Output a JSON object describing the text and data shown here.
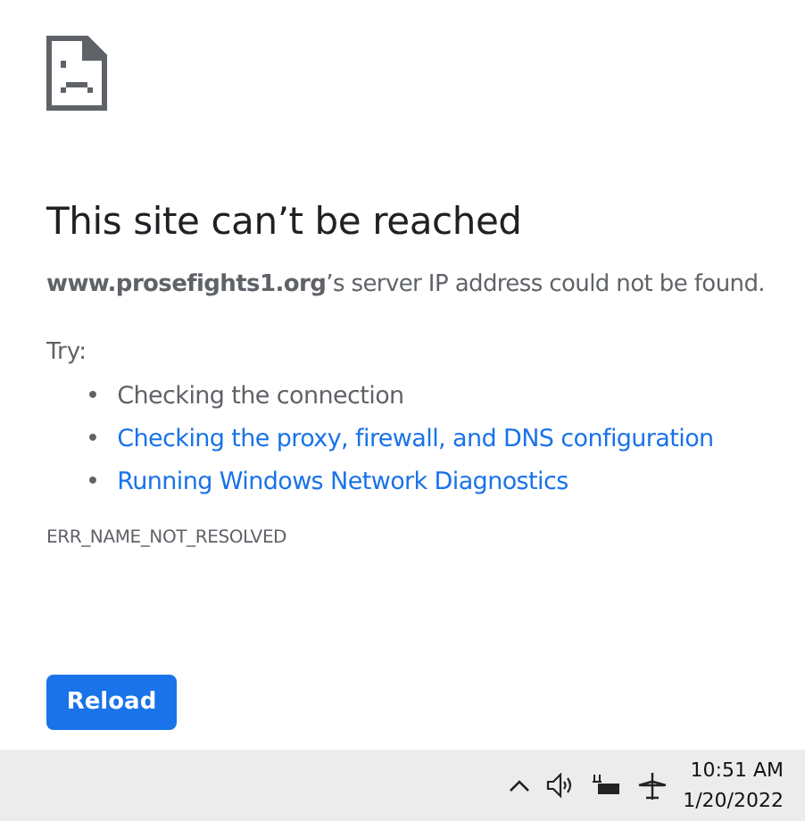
{
  "error_page": {
    "heading": "This site can’t be reached",
    "message": "**www.prosefights1.org**’s server IP address could not be found.",
    "try_label": "Try:",
    "suggestions": [
      {
        "kind": "text",
        "bullet": "•",
        "text": "Checking the connection"
      },
      {
        "kind": "link",
        "bullet": "•",
        "text": "Checking the proxy, firewall, and DNS configuration"
      },
      {
        "kind": "link",
        "bullet": "•",
        "text": "Running Windows Network Diagnostics"
      }
    ],
    "error_code": "ERR_NAME_NOT_RESOLVED",
    "reload_button": "Reload"
  },
  "taskbar": {
    "time": "10:51 AM",
    "date": "1/20/2022"
  }
}
